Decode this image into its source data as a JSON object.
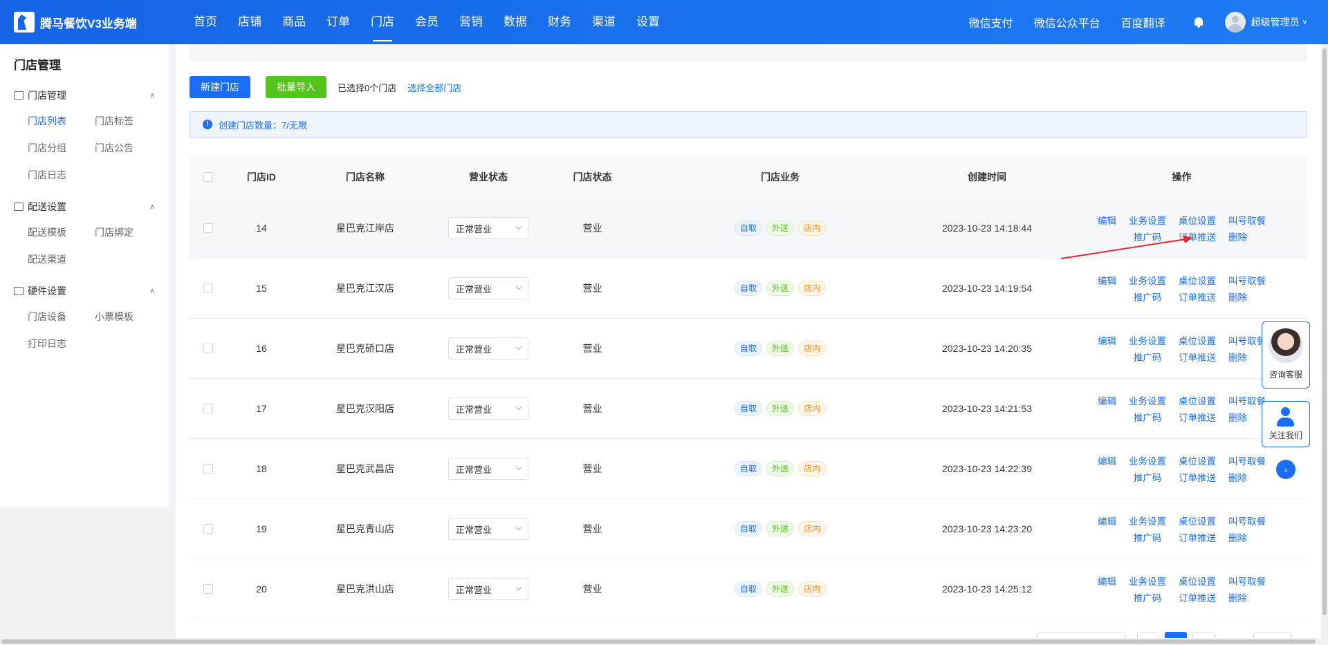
{
  "app": {
    "title": "腾马餐饮V3业务端"
  },
  "nav": {
    "items": [
      "首页",
      "店铺",
      "商品",
      "订单",
      "门店",
      "会员",
      "营销",
      "数据",
      "财务",
      "渠道",
      "设置"
    ],
    "active": 4
  },
  "top_links": [
    "微信支付",
    "微信公众平台",
    "百度翻译"
  ],
  "user": {
    "name": "超级管理员"
  },
  "sidebar": {
    "title": "门店管理",
    "groups": [
      {
        "label": "门店管理",
        "items": [
          "门店列表",
          "门店标签",
          "门店分组",
          "门店公告",
          "门店日志"
        ]
      },
      {
        "label": "配送设置",
        "items": [
          "配送模板",
          "门店绑定",
          "配送渠道"
        ]
      },
      {
        "label": "硬件设置",
        "items": [
          "门店设备",
          "小票模板",
          "打印日志"
        ]
      }
    ]
  },
  "toolbar": {
    "new_label": "新建门店",
    "import_label": "批量导入",
    "selected_text": "已选择0个门店",
    "select_all": "选择全部门店"
  },
  "alert": {
    "text": "创建门店数量：7/无限"
  },
  "table": {
    "headers": [
      "门店ID",
      "门店名称",
      "营业状态",
      "门店状态",
      "门店业务",
      "创建时间",
      "操作"
    ],
    "tags": [
      "自取",
      "外送",
      "店内"
    ],
    "ops": [
      "编辑",
      "业务设置",
      "桌位设置",
      "叫号取餐",
      "推广码",
      "订单推送",
      "删除"
    ],
    "rows": [
      {
        "id": "14",
        "name": "星巴克江岸店",
        "status": "正常营业",
        "state": "营业",
        "time": "2023-10-23 14:18:44"
      },
      {
        "id": "15",
        "name": "星巴克江汉店",
        "status": "正常营业",
        "state": "营业",
        "time": "2023-10-23 14:19:54"
      },
      {
        "id": "16",
        "name": "星巴克硚口店",
        "status": "正常营业",
        "state": "营业",
        "time": "2023-10-23 14:20:35"
      },
      {
        "id": "17",
        "name": "星巴克汉阳店",
        "status": "正常营业",
        "state": "营业",
        "time": "2023-10-23 14:21:53"
      },
      {
        "id": "18",
        "name": "星巴克武昌店",
        "status": "正常营业",
        "state": "营业",
        "time": "2023-10-23 14:22:39"
      },
      {
        "id": "19",
        "name": "星巴克青山店",
        "status": "正常营业",
        "state": "营业",
        "time": "2023-10-23 14:23:20"
      },
      {
        "id": "20",
        "name": "星巴克洪山店",
        "status": "正常营业",
        "state": "营业",
        "time": "2023-10-23 14:25:12"
      }
    ]
  },
  "float": {
    "cs_label": "咨询客服",
    "follow_label": "关注我们",
    "expand_icon": "chevron-right-icon"
  },
  "colors": {
    "primary": "#1a6ef5",
    "green": "#52c41a",
    "orange": "#fa8c16",
    "arrow": "#e8282b"
  }
}
